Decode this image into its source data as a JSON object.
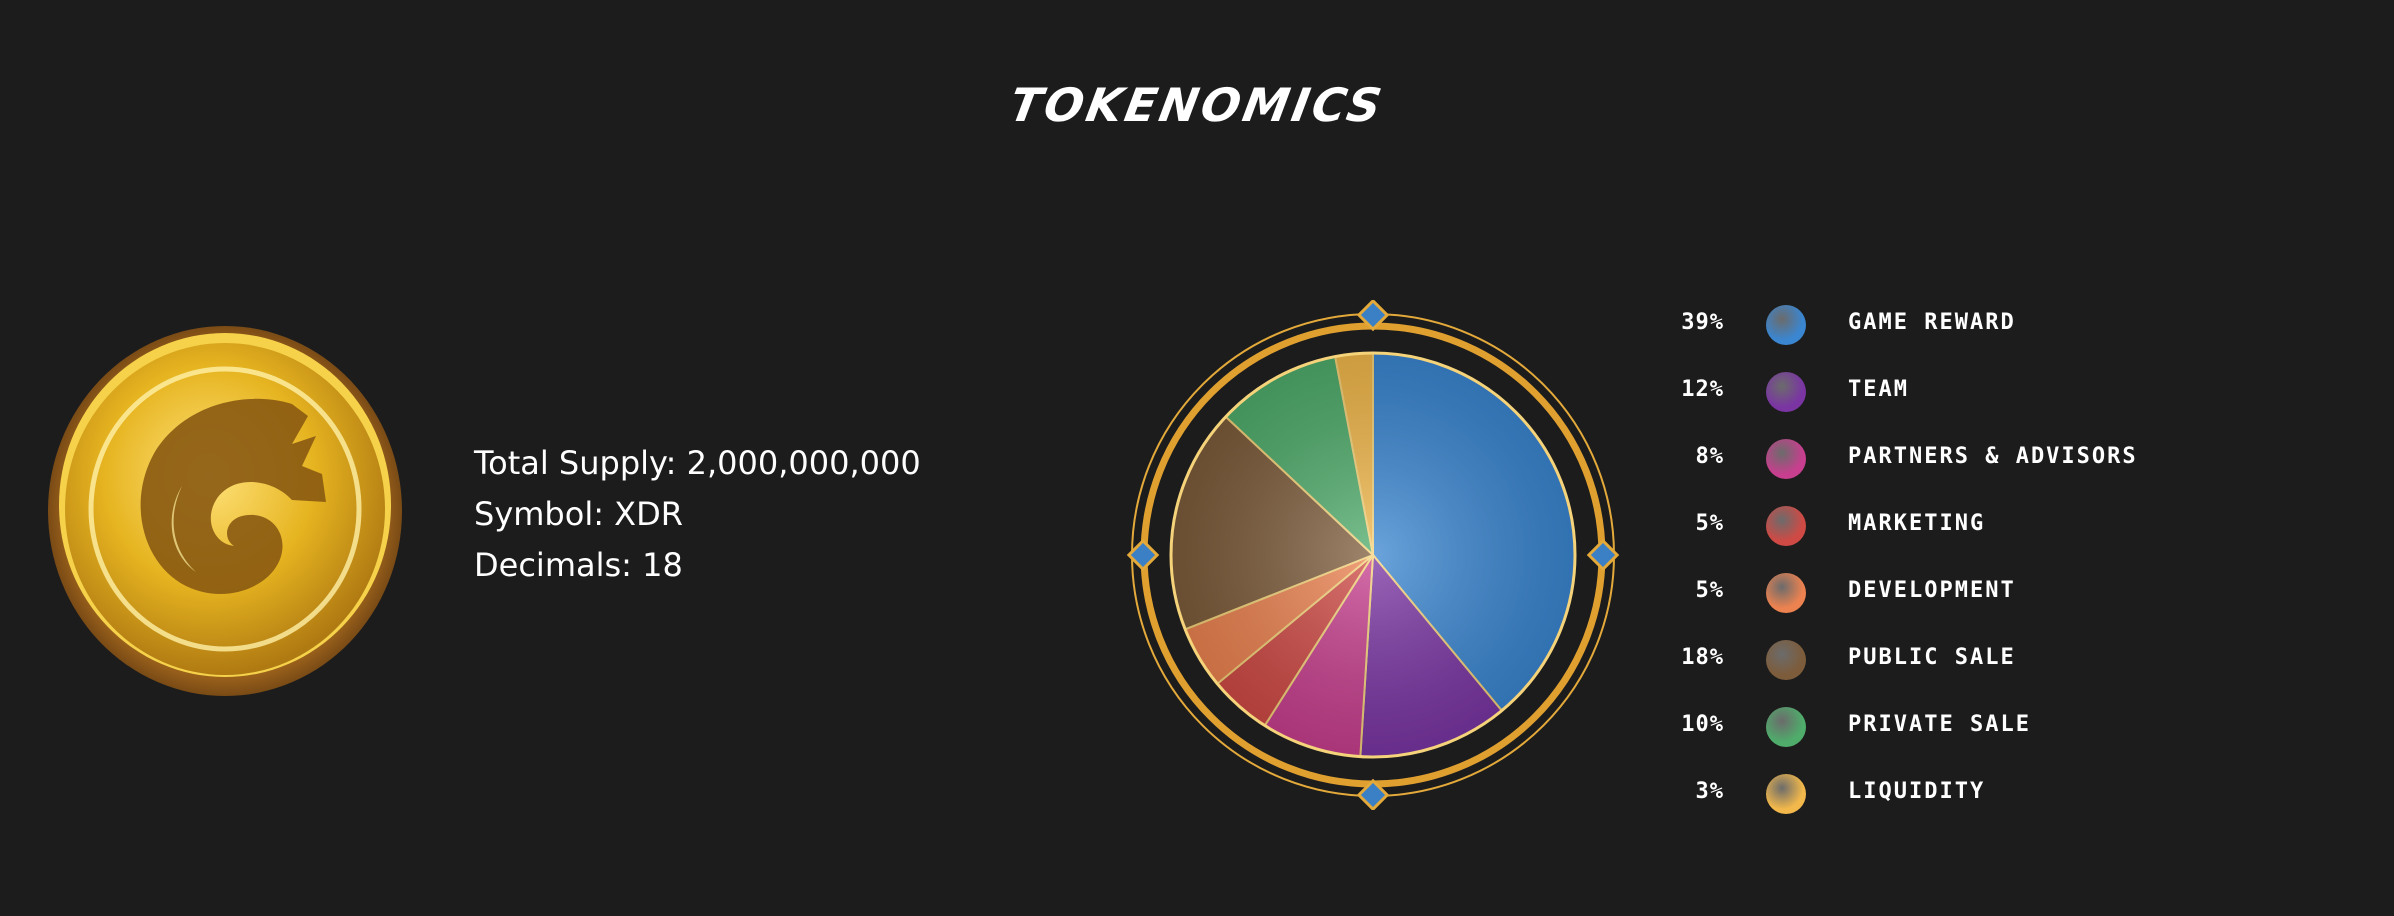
{
  "title": "TOKENOMICS",
  "info": {
    "total_supply": "Total Supply: 2,000,000,000",
    "symbol": "Symbol: XDR",
    "decimals": "Decimals: 18"
  },
  "chart_data": {
    "type": "pie",
    "categories": [
      "GAME REWARD",
      "TEAM",
      "PARTNERS & ADVISORS",
      "MARKETING",
      "DEVELOPMENT",
      "PUBLIC SALE",
      "PRIVATE SALE",
      "LIQUIDITY"
    ],
    "values": [
      39,
      12,
      8,
      5,
      5,
      18,
      10,
      3
    ],
    "labels": [
      "39%",
      "12%",
      "8%",
      "5%",
      "5%",
      "18%",
      "10%",
      "3%"
    ],
    "colors": [
      "#3a86d1",
      "#7a35a3",
      "#c73f8e",
      "#cf4a45",
      "#ec8250",
      "#7d5c3b",
      "#4fac6b",
      "#f2b84b"
    ],
    "legend_position": "right"
  }
}
